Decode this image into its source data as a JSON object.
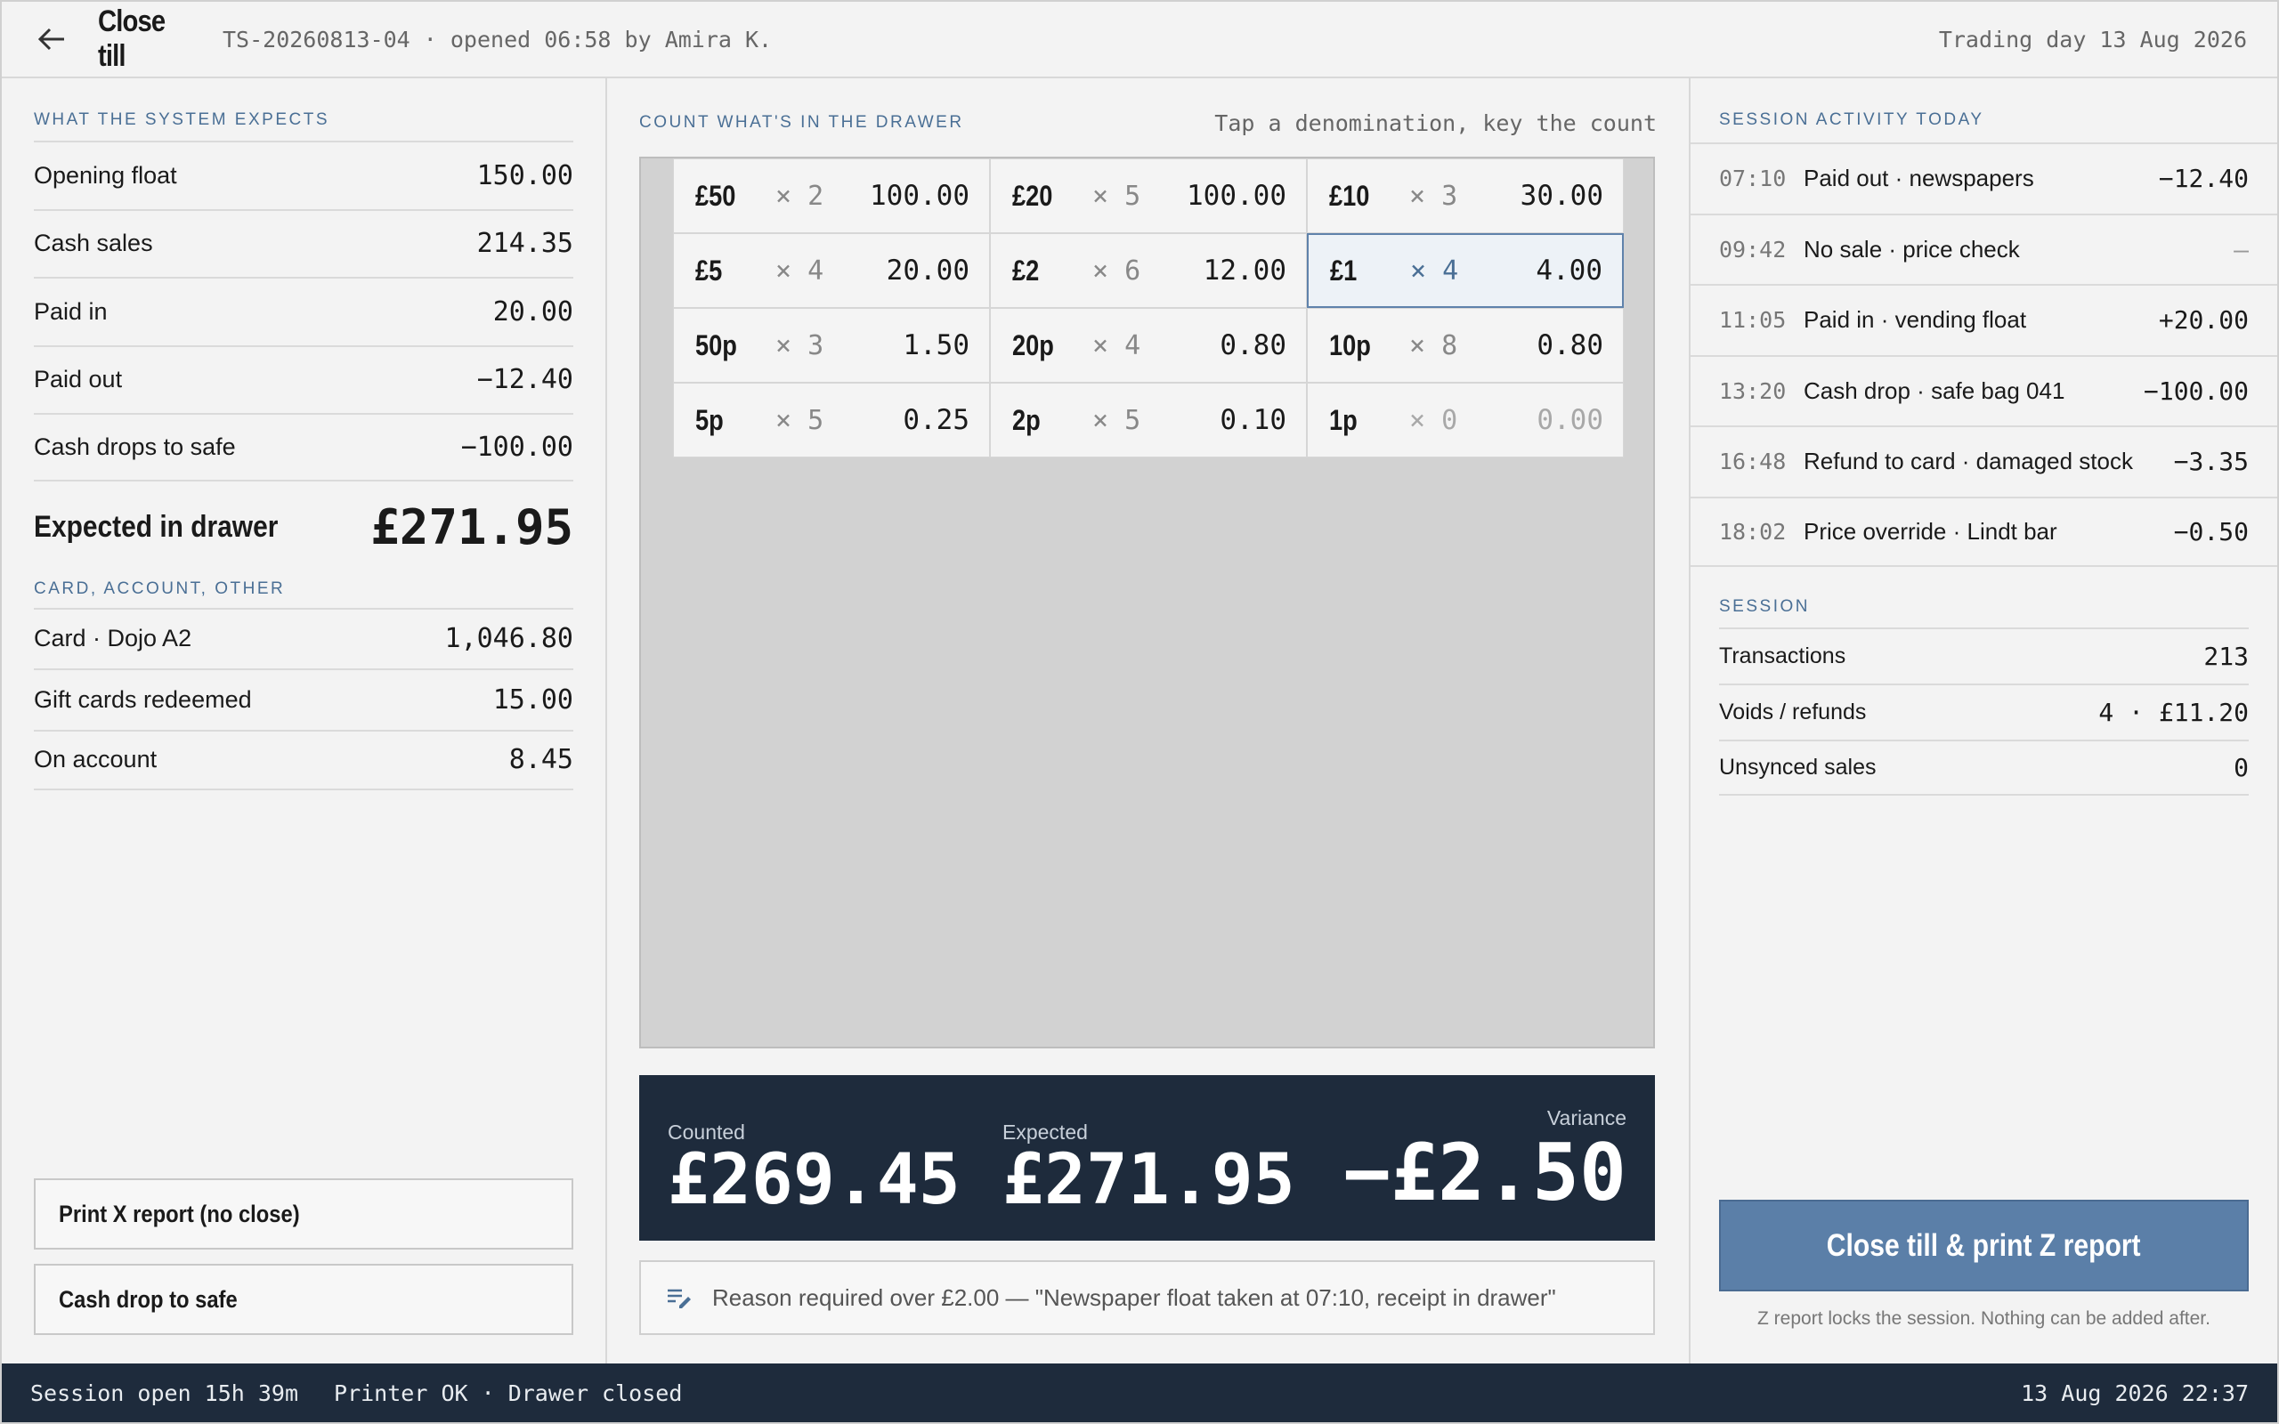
{
  "header": {
    "title": "Close till",
    "session": "TS-20260813-04 · opened 06:58 by Amira K.",
    "trading_day": "Trading day 13 Aug 2026"
  },
  "expects": {
    "label": "WHAT THE SYSTEM EXPECTS",
    "rows": [
      {
        "label": "Opening float",
        "value": "150.00"
      },
      {
        "label": "Cash sales",
        "value": "214.35"
      },
      {
        "label": "Paid in",
        "value": "20.00"
      },
      {
        "label": "Paid out",
        "value": "−12.40"
      },
      {
        "label": "Cash drops to safe",
        "value": "−100.00"
      }
    ],
    "expected_label": "Expected in drawer",
    "expected_value": "£271.95"
  },
  "other": {
    "label": "CARD, ACCOUNT, OTHER",
    "rows": [
      {
        "label": "Card · Dojo A2",
        "value": "1,046.80"
      },
      {
        "label": "Gift cards redeemed",
        "value": "15.00"
      },
      {
        "label": "On account",
        "value": "8.45"
      }
    ]
  },
  "left_buttons": {
    "x_report": "Print X report (no close)",
    "cash_drop": "Cash drop to safe"
  },
  "count": {
    "label": "COUNT WHAT'S IN THE DRAWER",
    "hint": "Tap a denomination, key the count",
    "denoms": [
      {
        "d": "£50",
        "q": "× 2",
        "t": "100.00"
      },
      {
        "d": "£20",
        "q": "× 5",
        "t": "100.00"
      },
      {
        "d": "£10",
        "q": "× 3",
        "t": "30.00"
      },
      {
        "d": "£5",
        "q": "× 4",
        "t": "20.00"
      },
      {
        "d": "£2",
        "q": "× 6",
        "t": "12.00"
      },
      {
        "d": "£1",
        "q": "× 4",
        "t": "4.00"
      },
      {
        "d": "50p",
        "q": "× 3",
        "t": "1.50"
      },
      {
        "d": "20p",
        "q": "× 4",
        "t": "0.80"
      },
      {
        "d": "10p",
        "q": "× 8",
        "t": "0.80"
      },
      {
        "d": "5p",
        "q": "× 5",
        "t": "0.25"
      },
      {
        "d": "2p",
        "q": "× 5",
        "t": "0.10"
      },
      {
        "d": "1p",
        "q": "× 0",
        "t": "0.00"
      }
    ]
  },
  "totals": {
    "counted_label": "Counted",
    "counted": "£269.45",
    "expected_label": "Expected",
    "expected": "£271.95",
    "variance_label": "Variance",
    "variance": "−£2.50"
  },
  "reason": "Reason required over £2.00 — \"Newspaper float taken at 07:10, receipt in drawer\"",
  "activity": {
    "label": "SESSION ACTIVITY TODAY",
    "items": [
      {
        "time": "07:10",
        "desc": "Paid out · newspapers",
        "amount": "−12.40"
      },
      {
        "time": "09:42",
        "desc": "No sale · price check",
        "amount": "—"
      },
      {
        "time": "11:05",
        "desc": "Paid in · vending float",
        "amount": "+20.00"
      },
      {
        "time": "13:20",
        "desc": "Cash drop · safe bag 041",
        "amount": "−100.00"
      },
      {
        "time": "16:48",
        "desc": "Refund to card · damaged stock",
        "amount": "−3.35"
      },
      {
        "time": "18:02",
        "desc": "Price override · Lindt bar",
        "amount": "−0.50"
      }
    ]
  },
  "session": {
    "label": "SESSION",
    "rows": [
      {
        "label": "Transactions",
        "value": "213"
      },
      {
        "label": "Voids / refunds",
        "value": "4 · £11.20"
      },
      {
        "label": "Unsynced sales",
        "value": "0"
      }
    ]
  },
  "close_button": "Close till & print Z report",
  "close_note": "Z report locks the session. Nothing can be added after.",
  "footer": {
    "session": "Session open 15h 39m",
    "status": "Printer OK · Drawer closed",
    "datetime": "13 Aug 2026 22:37"
  }
}
